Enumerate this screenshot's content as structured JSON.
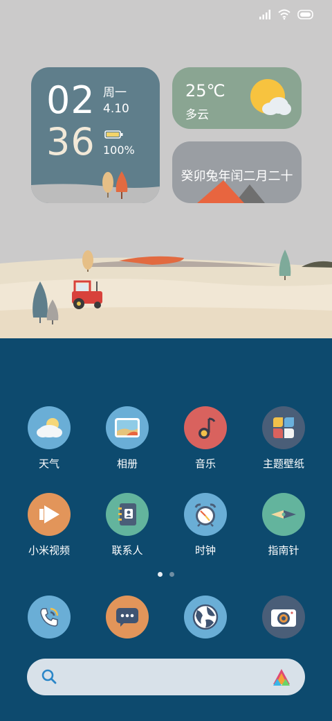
{
  "status_bar": {
    "icons": [
      "signal-icon",
      "wifi-icon",
      "battery-icon"
    ]
  },
  "clock_widget": {
    "hour": "02",
    "minute": "36",
    "weekday": "周一",
    "date": "4.10",
    "battery": "100%"
  },
  "weather_widget": {
    "temperature": "25℃",
    "condition": "多云",
    "icon": "partly-cloudy-icon"
  },
  "calendar_widget": {
    "lunar_date": "癸卯兔年闰二月二十"
  },
  "apps": [
    {
      "label": "天气",
      "icon": "weather-icon",
      "color": "#6aaed6"
    },
    {
      "label": "相册",
      "icon": "gallery-icon",
      "color": "#6aaed6"
    },
    {
      "label": "音乐",
      "icon": "music-icon",
      "color": "#d9625e"
    },
    {
      "label": "主题壁纸",
      "icon": "themes-icon",
      "color": "#4a5e78"
    },
    {
      "label": "小米视频",
      "icon": "video-icon",
      "color": "#e2955a"
    },
    {
      "label": "联系人",
      "icon": "contacts-icon",
      "color": "#63b49d"
    },
    {
      "label": "时钟",
      "icon": "clock-icon",
      "color": "#6aaed6"
    },
    {
      "label": "指南针",
      "icon": "compass-icon",
      "color": "#63b49d"
    }
  ],
  "page_indicator": {
    "pages": 2,
    "current": 1
  },
  "dock": [
    {
      "icon": "phone-icon",
      "color": "#6aaed6"
    },
    {
      "icon": "messages-icon",
      "color": "#e2955a"
    },
    {
      "icon": "browser-icon",
      "color": "#6aaed6"
    },
    {
      "icon": "camera-icon",
      "color": "#4a5e78"
    }
  ],
  "search": {
    "placeholder": "",
    "assistant_icon": "assistant-icon"
  },
  "colors": {
    "sky": "#cbcaca",
    "lower": "#0d4a6e",
    "sand": "#e9dfca"
  }
}
